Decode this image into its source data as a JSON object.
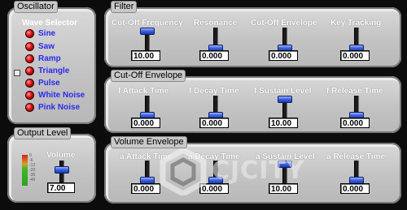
{
  "oscillator": {
    "title": "Oscillator",
    "wave_selector_label": "Wave Selector",
    "waves": [
      "Sine",
      "Saw",
      "Ramp",
      "Triangle",
      "Pulse",
      "White Noise",
      "Pink Noise"
    ],
    "selected": "Triangle"
  },
  "output_level": {
    "title": "Output Level",
    "meter_scale": [
      "0",
      "-6",
      "-12",
      "-20",
      "-30",
      "-40"
    ],
    "volume": {
      "label": "Volume",
      "value": "7.00"
    }
  },
  "filter": {
    "title": "Filter",
    "knobs": [
      {
        "label": "Cut-Off Frequency",
        "value": "10.00"
      },
      {
        "label": "Resonance",
        "value": "0.000"
      },
      {
        "label": "Cut-Off Envelope",
        "value": "0.000"
      },
      {
        "label": "Key Tracking",
        "value": "0.000"
      }
    ]
  },
  "cutoff_envelope": {
    "title": "Cut-Off Envelope",
    "knobs": [
      {
        "label": "f Attack Time",
        "value": "0.000"
      },
      {
        "label": "f Decay Time",
        "value": "0.000"
      },
      {
        "label": "f Sustain Level",
        "value": "10.00"
      },
      {
        "label": "f Release Time",
        "value": "0.000"
      }
    ]
  },
  "volume_envelope": {
    "title": "Volume Envelope",
    "knobs": [
      {
        "label": "a Attack Time",
        "value": "0.000"
      },
      {
        "label": "a Decay Time",
        "value": "0.000"
      },
      {
        "label": "a Sustain Level",
        "value": "10.00"
      },
      {
        "label": "a Release Time",
        "value": "0.000"
      }
    ]
  },
  "watermark": {
    "text": "CJCITY"
  },
  "colors": {
    "panel": "#c8c8c8",
    "led": "#e01010",
    "wave_text": "#2a2aee",
    "slider_thumb": "#3e63e0"
  }
}
